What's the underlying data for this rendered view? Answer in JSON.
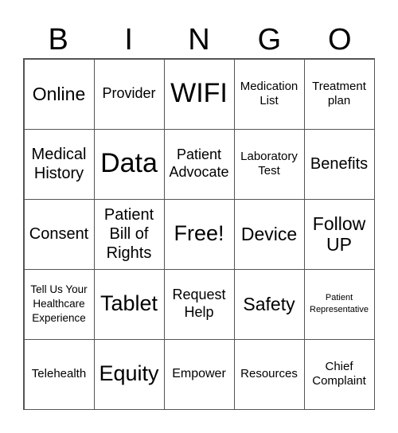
{
  "header": {
    "letters": [
      "B",
      "I",
      "N",
      "G",
      "O"
    ]
  },
  "board": {
    "rows": [
      [
        "Online",
        "Provider",
        "WIFI",
        "Medication List",
        "Treatment plan"
      ],
      [
        "Medical History",
        "Data",
        "Patient Advocate",
        "Laboratory Test",
        "Benefits"
      ],
      [
        "Consent",
        "Patient Bill of Rights",
        "Free!",
        "Device",
        "Follow UP"
      ],
      [
        "Tell Us Your Healthcare Experience",
        "Tablet",
        "Request Help",
        "Safety",
        "Patient Representative"
      ],
      [
        "Telehealth",
        "Equity",
        "Empower",
        "Resources",
        "Chief Complaint"
      ]
    ]
  }
}
